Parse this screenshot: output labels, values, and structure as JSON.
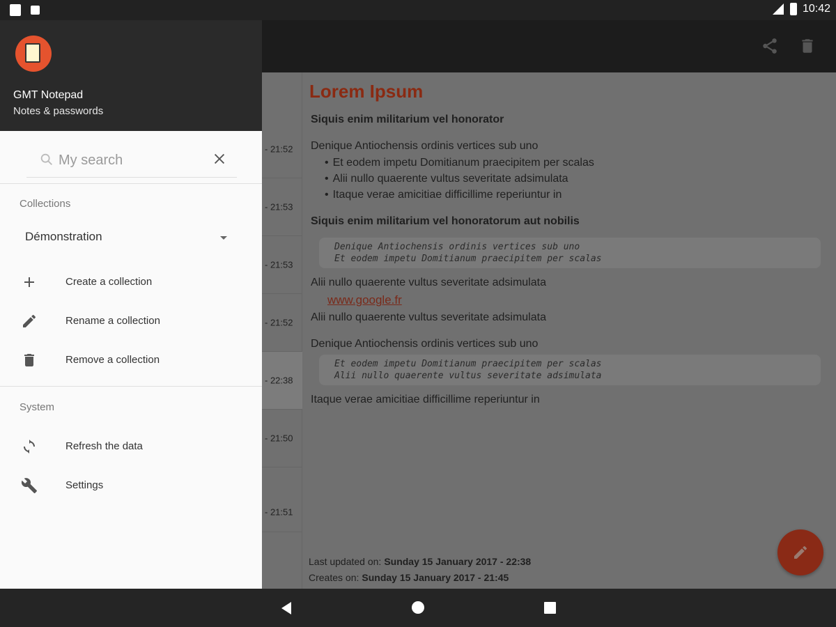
{
  "status_bar": {
    "time": "10:42"
  },
  "drawer": {
    "app_name": "GMT Notepad",
    "app_subtitle": "Notes & passwords",
    "search_placeholder": "My search",
    "collections_label": "Collections",
    "selected_collection": "Démonstration",
    "collection_actions": [
      {
        "label": "Create a collection",
        "icon": "plus-icon"
      },
      {
        "label": "Rename a collection",
        "icon": "pencil-icon"
      },
      {
        "label": "Remove a collection",
        "icon": "trash-icon"
      }
    ],
    "system_label": "System",
    "system_actions": [
      {
        "label": "Refresh the data",
        "icon": "refresh-icon"
      },
      {
        "label": "Settings",
        "icon": "wrench-icon"
      }
    ]
  },
  "note_list": {
    "times": [
      "- 21:52",
      "- 21:53",
      "- 21:53",
      "- 21:52",
      "- 22:38",
      "- 21:50",
      "- 21:51"
    ]
  },
  "note": {
    "title": "Lorem Ipsum",
    "heading1": "Siquis enim militarium vel honorator",
    "para1": "Denique Antiochensis ordinis vertices sub uno",
    "bullets": [
      "Et eodem impetu Domitianum praecipitem per scalas",
      "Alii nullo quaerente vultus severitate adsimulata",
      "Itaque verae amicitiae difficillime reperiuntur in"
    ],
    "heading2": "Siquis enim militarium vel honoratorum aut nobilis",
    "code1": [
      "Denique Antiochensis ordinis vertices sub uno",
      "Et eodem impetu Domitianum praecipitem per scalas"
    ],
    "para2": "Alii nullo quaerente vultus severitate adsimulata",
    "link": "www.google.fr",
    "para3": "Alii nullo quaerente vultus severitate adsimulata",
    "para4": "Denique Antiochensis ordinis vertices sub uno",
    "code2": [
      "Et eodem impetu Domitianum praecipitem per scalas",
      "Alii nullo quaerente vultus severitate adsimulata"
    ],
    "para5": "Itaque verae amicitiae difficillime reperiuntur in",
    "last_updated_label": "Last updated on:",
    "last_updated_value": "Sunday 15 January 2017 - 22:38",
    "created_label": "Creates on:",
    "created_value": "Sunday 15 January 2017 - 21:45"
  },
  "colors": {
    "accent": "#e5532e",
    "drawer_header": "#2a2a2a",
    "scrim": "#707070"
  }
}
